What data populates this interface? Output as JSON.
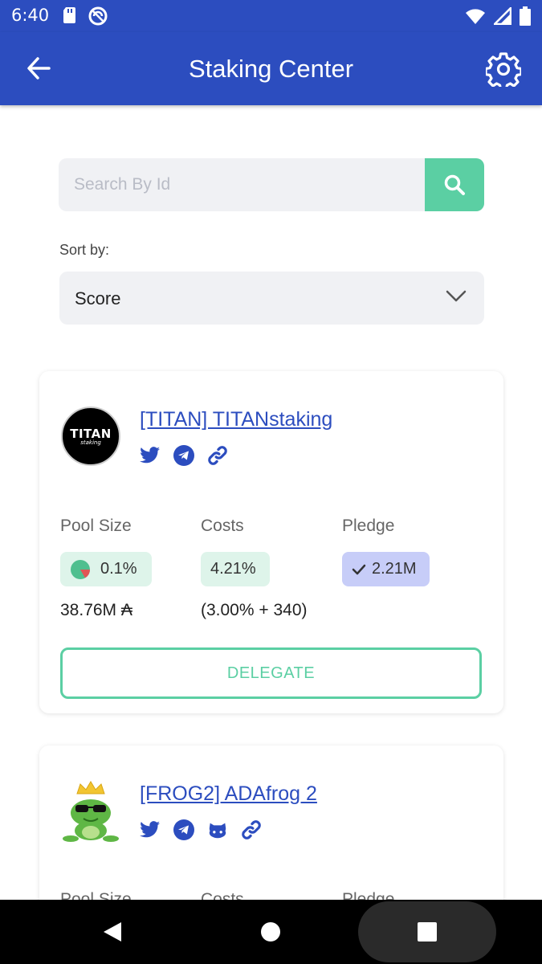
{
  "status_bar": {
    "time": "6:40",
    "left_icons": [
      "sd-card-icon",
      "no-sim-circle-icon"
    ],
    "right_icons": [
      "wifi-icon",
      "signal-icon",
      "battery-icon"
    ]
  },
  "app_bar": {
    "title": "Staking Center",
    "back_icon": "back-arrow-icon",
    "settings_icon": "gear-icon",
    "color": "#2c4dbf"
  },
  "search": {
    "placeholder": "Search By Id",
    "value": "",
    "button_icon": "search-icon",
    "button_color": "#5bcfa3"
  },
  "sort": {
    "label": "Sort by:",
    "selected": "Score"
  },
  "pools": [
    {
      "name": "[TITAN] TITANstaking",
      "avatar_text": "TITAN",
      "avatar_subtext": "staking",
      "socials": [
        "twitter-icon",
        "telegram-icon",
        "link-icon"
      ],
      "pool_size_label": "Pool Size",
      "pool_size_percent": "0.1%",
      "pool_size_amount": "38.76M ₳",
      "costs_label": "Costs",
      "costs_value": "4.21%",
      "costs_detail": "(3.00% + 340)",
      "pledge_label": "Pledge",
      "pledge_value": "2.21M",
      "delegate_label": "DELEGATE"
    },
    {
      "name": "[FROG2] ADAfrog 2",
      "socials": [
        "twitter-icon",
        "telegram-icon",
        "github-icon",
        "link-icon"
      ],
      "pool_size_label": "Pool Size",
      "costs_label": "Costs",
      "pledge_label": "Pledge"
    }
  ],
  "nav_bar": {
    "buttons": [
      "back-triangle-icon",
      "home-circle-icon",
      "recents-square-icon"
    ]
  }
}
